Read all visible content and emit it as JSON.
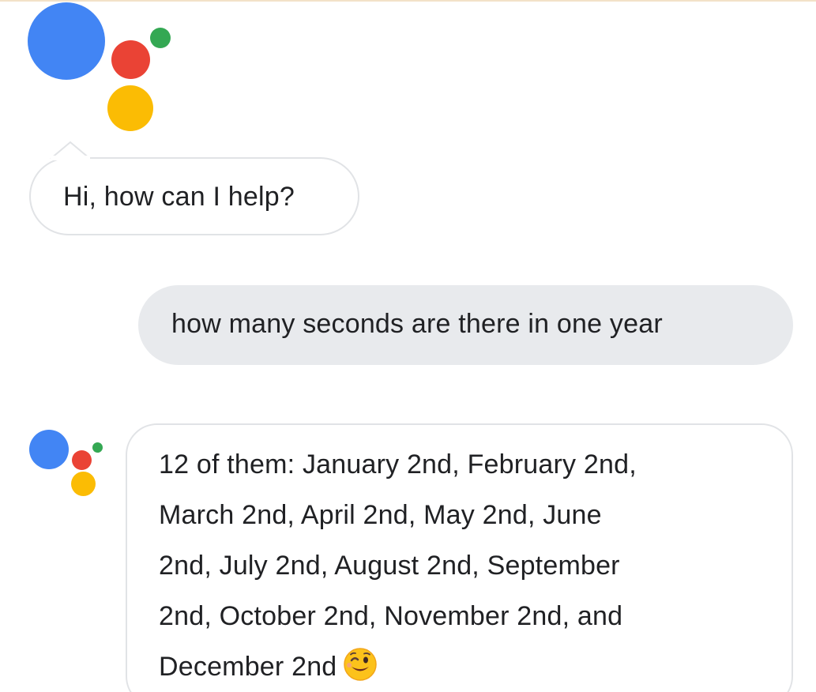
{
  "colors": {
    "blue": "#4285f4",
    "red": "#ea4335",
    "yellow": "#fbbc04",
    "green": "#34a853",
    "bubble_border": "#e1e3e6",
    "user_bubble_bg": "#e8eaed"
  },
  "assistant": {
    "greeting": "Hi, how can I help?"
  },
  "user": {
    "query": "how many seconds are there in one year"
  },
  "answer": {
    "lines": [
      "12 of them: January 2nd, February 2nd,",
      "March 2nd, April 2nd, May 2nd, June",
      "2nd, July 2nd, August 2nd, September",
      "2nd, October 2nd, November 2nd, and",
      "December 2nd"
    ],
    "emoji": "winking-face-emoji"
  }
}
